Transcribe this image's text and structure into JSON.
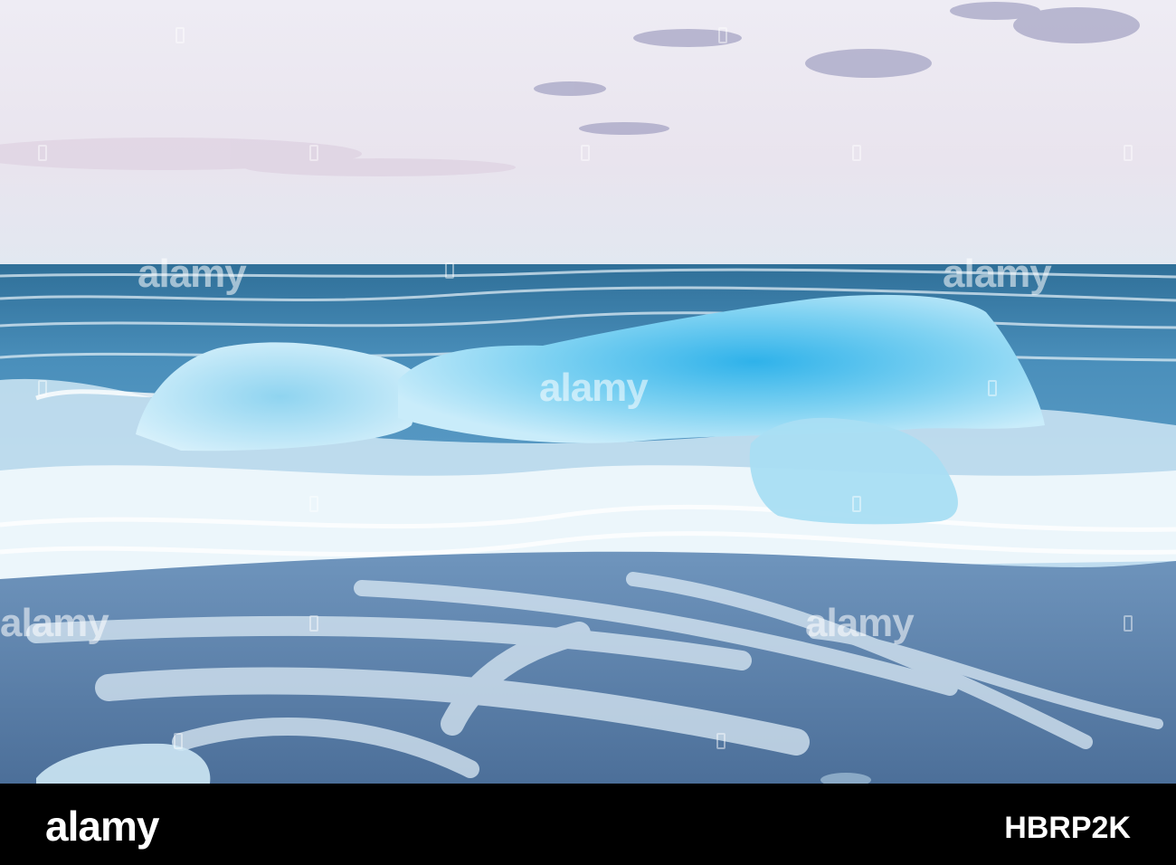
{
  "watermark": {
    "text": "alamy"
  },
  "footer": {
    "logo": "alamy",
    "image_id": "HBRP2K"
  },
  "colors": {
    "sky_top": "#eceaf3",
    "sky_bottom": "#e4e6f0",
    "sea": "#3f86b3",
    "ice": "#5fc8ec",
    "foam": "#eaf4fb",
    "sand": "#5a7ea6"
  }
}
